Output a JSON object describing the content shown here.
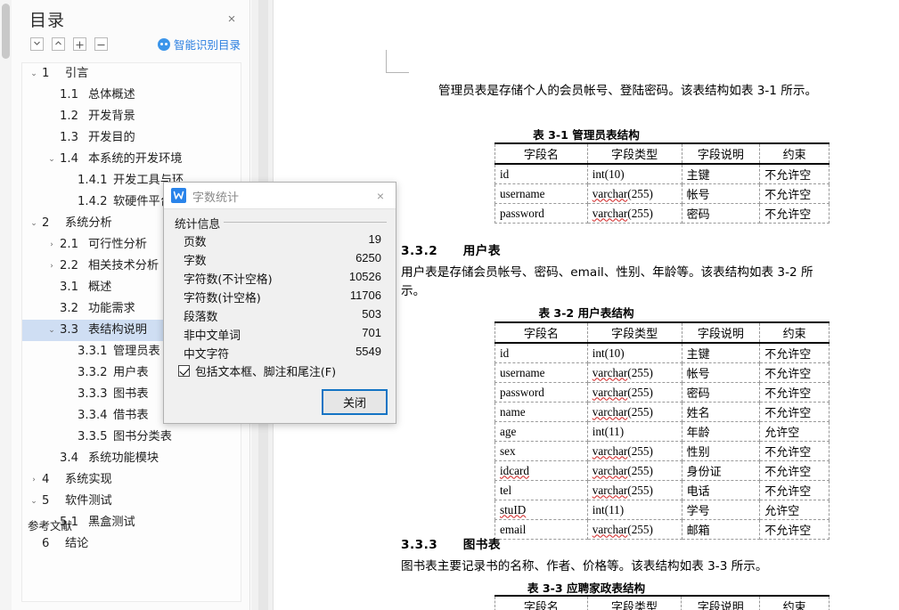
{
  "toc": {
    "title": "目录",
    "close_label": "×",
    "smart_toc_label": "智能识别目录",
    "toolbar": [
      {
        "name": "expand-down-button",
        "label": "∨"
      },
      {
        "name": "collapse-up-button",
        "label": "∧"
      },
      {
        "name": "increase-level-button",
        "label": "+"
      },
      {
        "name": "decrease-level-button",
        "label": "−"
      }
    ],
    "items": [
      {
        "arrow": "∨",
        "num": "1",
        "text": "引言",
        "indent": 0,
        "selected": false
      },
      {
        "arrow": "",
        "num": "1.1",
        "text": "总体概述",
        "indent": 1,
        "selected": false
      },
      {
        "arrow": "",
        "num": "1.2",
        "text": "开发背景",
        "indent": 1,
        "selected": false
      },
      {
        "arrow": "",
        "num": "1.3",
        "text": "开发目的",
        "indent": 1,
        "selected": false
      },
      {
        "arrow": "∨",
        "num": "1.4",
        "text": "本系统的开发环境",
        "indent": 1,
        "selected": false
      },
      {
        "arrow": "",
        "num": "1.4.1",
        "text": "开发工具与环",
        "indent": 2,
        "selected": false
      },
      {
        "arrow": "",
        "num": "1.4.2",
        "text": "软硬件平台选",
        "indent": 2,
        "selected": false
      },
      {
        "arrow": "∨",
        "num": "2",
        "text": "系统分析",
        "indent": 0,
        "selected": false
      },
      {
        "arrow": "›",
        "num": "2.1",
        "text": "可行性分析",
        "indent": 1,
        "selected": false
      },
      {
        "arrow": "›",
        "num": "2.2",
        "text": "相关技术分析",
        "indent": 1,
        "selected": false
      },
      {
        "arrow": "",
        "num": "3.1",
        "text": "概述",
        "indent": 1,
        "selected": false
      },
      {
        "arrow": "",
        "num": "3.2",
        "text": "功能需求",
        "indent": 1,
        "selected": false
      },
      {
        "arrow": "∨",
        "num": "3.3",
        "text": "表结构说明",
        "indent": 1,
        "selected": true
      },
      {
        "arrow": "",
        "num": "3.3.1",
        "text": "管理员表",
        "indent": 2,
        "selected": false
      },
      {
        "arrow": "",
        "num": "3.3.2",
        "text": "用户表",
        "indent": 2,
        "selected": false
      },
      {
        "arrow": "",
        "num": "3.3.3",
        "text": "图书表",
        "indent": 2,
        "selected": false
      },
      {
        "arrow": "",
        "num": "3.3.4",
        "text": "借书表",
        "indent": 2,
        "selected": false
      },
      {
        "arrow": "",
        "num": "3.3.5",
        "text": "图书分类表",
        "indent": 2,
        "selected": false
      },
      {
        "arrow": "",
        "num": "3.4",
        "text": "系统功能模块",
        "indent": 1,
        "selected": false
      },
      {
        "arrow": "›",
        "num": "4",
        "text": "系统实现",
        "indent": 0,
        "selected": false
      },
      {
        "arrow": "∨",
        "num": "5",
        "text": "软件测试",
        "indent": 0,
        "selected": false
      },
      {
        "arrow": "",
        "num": "5.1",
        "text": "黑盒测试",
        "indent": 1,
        "selected": false
      },
      {
        "arrow": "",
        "num": "6",
        "text": "结论",
        "indent": 0,
        "selected": false
      }
    ],
    "references_label": "参考文献"
  },
  "dialog": {
    "title": "字数统计",
    "close_label": "×",
    "group_label": "统计信息",
    "stats": [
      {
        "label": "页数",
        "value": "19"
      },
      {
        "label": "字数",
        "value": "6250"
      },
      {
        "label": "字符数(不计空格)",
        "value": "10526"
      },
      {
        "label": "字符数(计空格)",
        "value": "11706"
      },
      {
        "label": "段落数",
        "value": "503"
      },
      {
        "label": "非中文单词",
        "value": "701"
      },
      {
        "label": "中文字符",
        "value": "5549"
      }
    ],
    "checkbox_label": "包括文本框、脚注和尾注(F)",
    "checkbox_checked": true,
    "close_button_label": "关闭",
    "accent_color": "#1474c4"
  },
  "document": {
    "intro_paragraph": "管理员表是存储个人的会员帐号、登陆密码。该表结构如表 3-1 所示。",
    "table1": {
      "caption": "表 3-1  管理员表结构",
      "headers": [
        "字段名",
        "字段类型",
        "字段说明",
        "约束"
      ],
      "rows": [
        [
          "id",
          "int(10)",
          "主键",
          "不允许空"
        ],
        [
          "username",
          "varchar(255)",
          "帐号",
          "不允许空"
        ],
        [
          "password",
          "varchar(255)",
          "密码",
          "不允许空"
        ]
      ]
    },
    "section2": {
      "number": "3.3.2",
      "title": "用户表",
      "paragraph": "用户表是存储会员帐号、密码、email、性别、年龄等。该表结构如表 3-2 所",
      "paragraph_cont": "示。"
    },
    "table2": {
      "caption": "表 3-2  用户表结构",
      "headers": [
        "字段名",
        "字段类型",
        "字段说明",
        "约束"
      ],
      "rows": [
        [
          "id",
          "int(10)",
          "主键",
          "不允许空"
        ],
        [
          "username",
          "varchar(255)",
          "帐号",
          "不允许空"
        ],
        [
          "password",
          "varchar(255)",
          "密码",
          "不允许空"
        ],
        [
          "name",
          "varchar(255)",
          "姓名",
          "不允许空"
        ],
        [
          "age",
          "int(11)",
          "年龄",
          "允许空"
        ],
        [
          "sex",
          "varchar(255)",
          "性别",
          "不允许空"
        ],
        [
          "idcard",
          "varchar(255)",
          "身份证",
          "不允许空"
        ],
        [
          "tel",
          "varchar(255)",
          "电话",
          "不允许空"
        ],
        [
          "stuID",
          "int(11)",
          "学号",
          "允许空"
        ],
        [
          "email",
          "varchar(255)",
          "邮箱",
          "不允许空"
        ]
      ]
    },
    "section3": {
      "number": "3.3.3",
      "title": "图书表",
      "paragraph": "图书表主要记录书的名称、作者、价格等。该表结构如表 3-3 所示。"
    },
    "table3": {
      "caption": "表 3-3 应聘家政表结构",
      "headers": [
        "字段名",
        "字段类型",
        "字段说明",
        "约束"
      ]
    }
  }
}
